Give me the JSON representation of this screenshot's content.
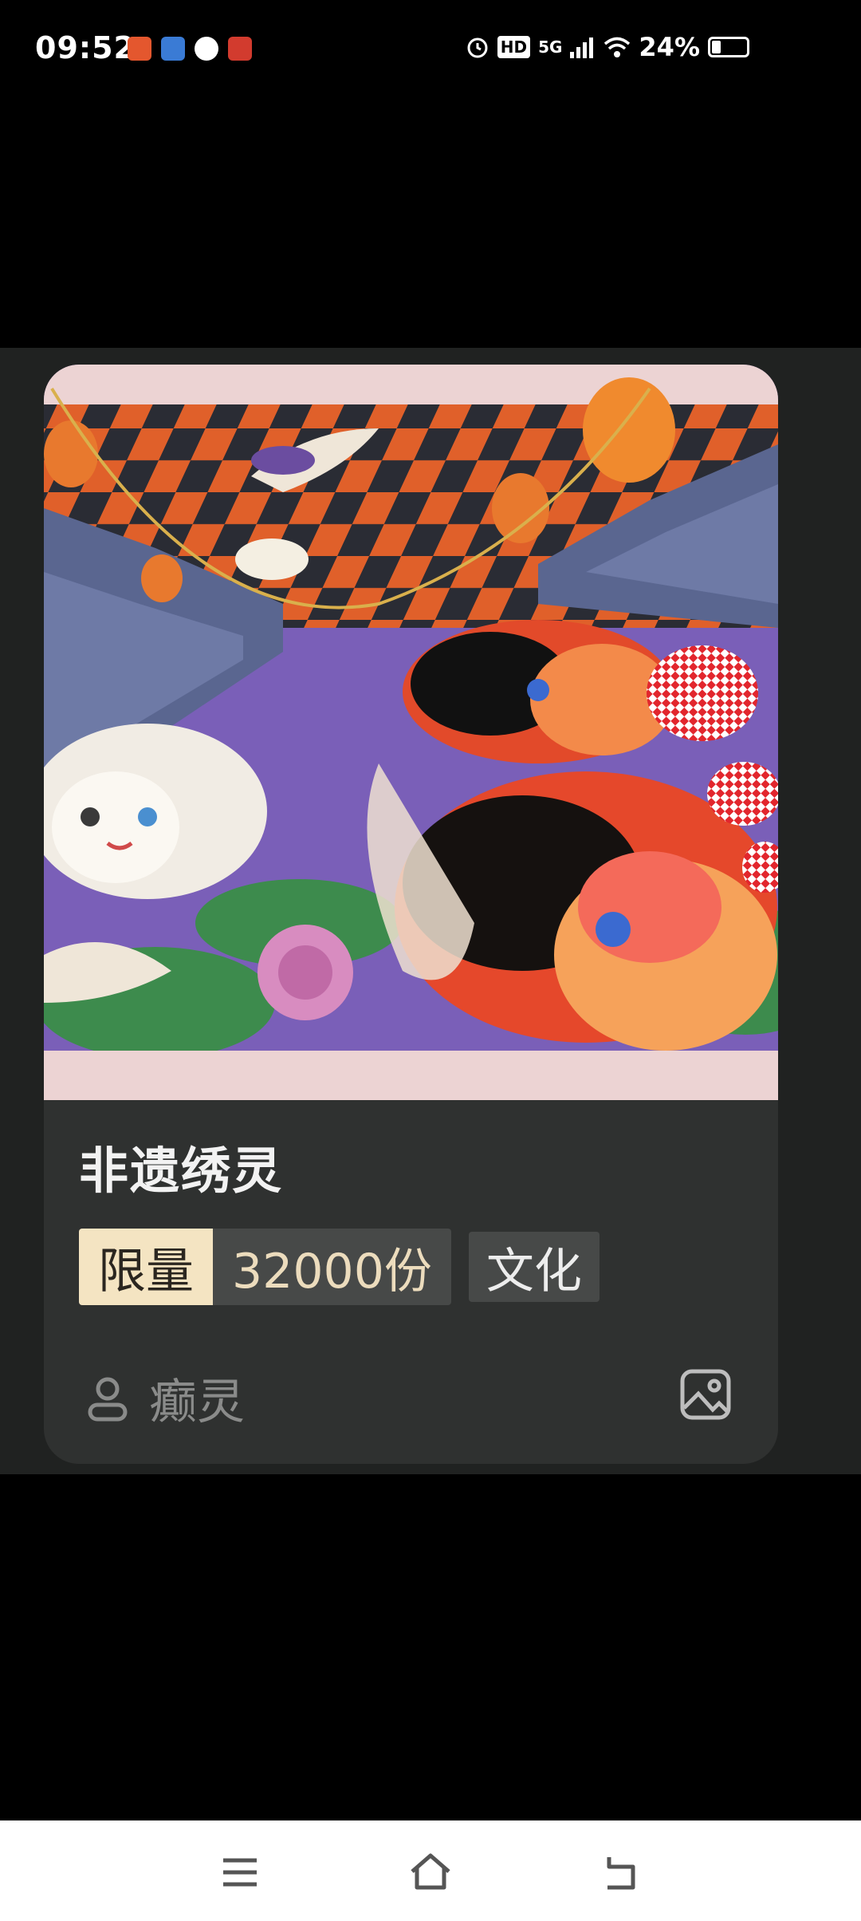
{
  "status_bar": {
    "time": "09:52",
    "signal_label": "5G",
    "hd_label": "HD",
    "battery_percent": "24%",
    "battery_level": 0.24
  },
  "card": {
    "title": "非遗绣灵",
    "limit_label": "限量",
    "limit_value": "32000份",
    "category": "文化",
    "creator": "癫灵"
  },
  "colors": {
    "card_bg": "#2f3130",
    "limit_tag_bg": "#f4e4c2",
    "tag_bg": "#474948"
  },
  "icons": {
    "creator": "user-icon",
    "gallery": "image-icon",
    "nav_menu": "menu-icon",
    "nav_home": "home-icon",
    "nav_back": "back-icon"
  }
}
